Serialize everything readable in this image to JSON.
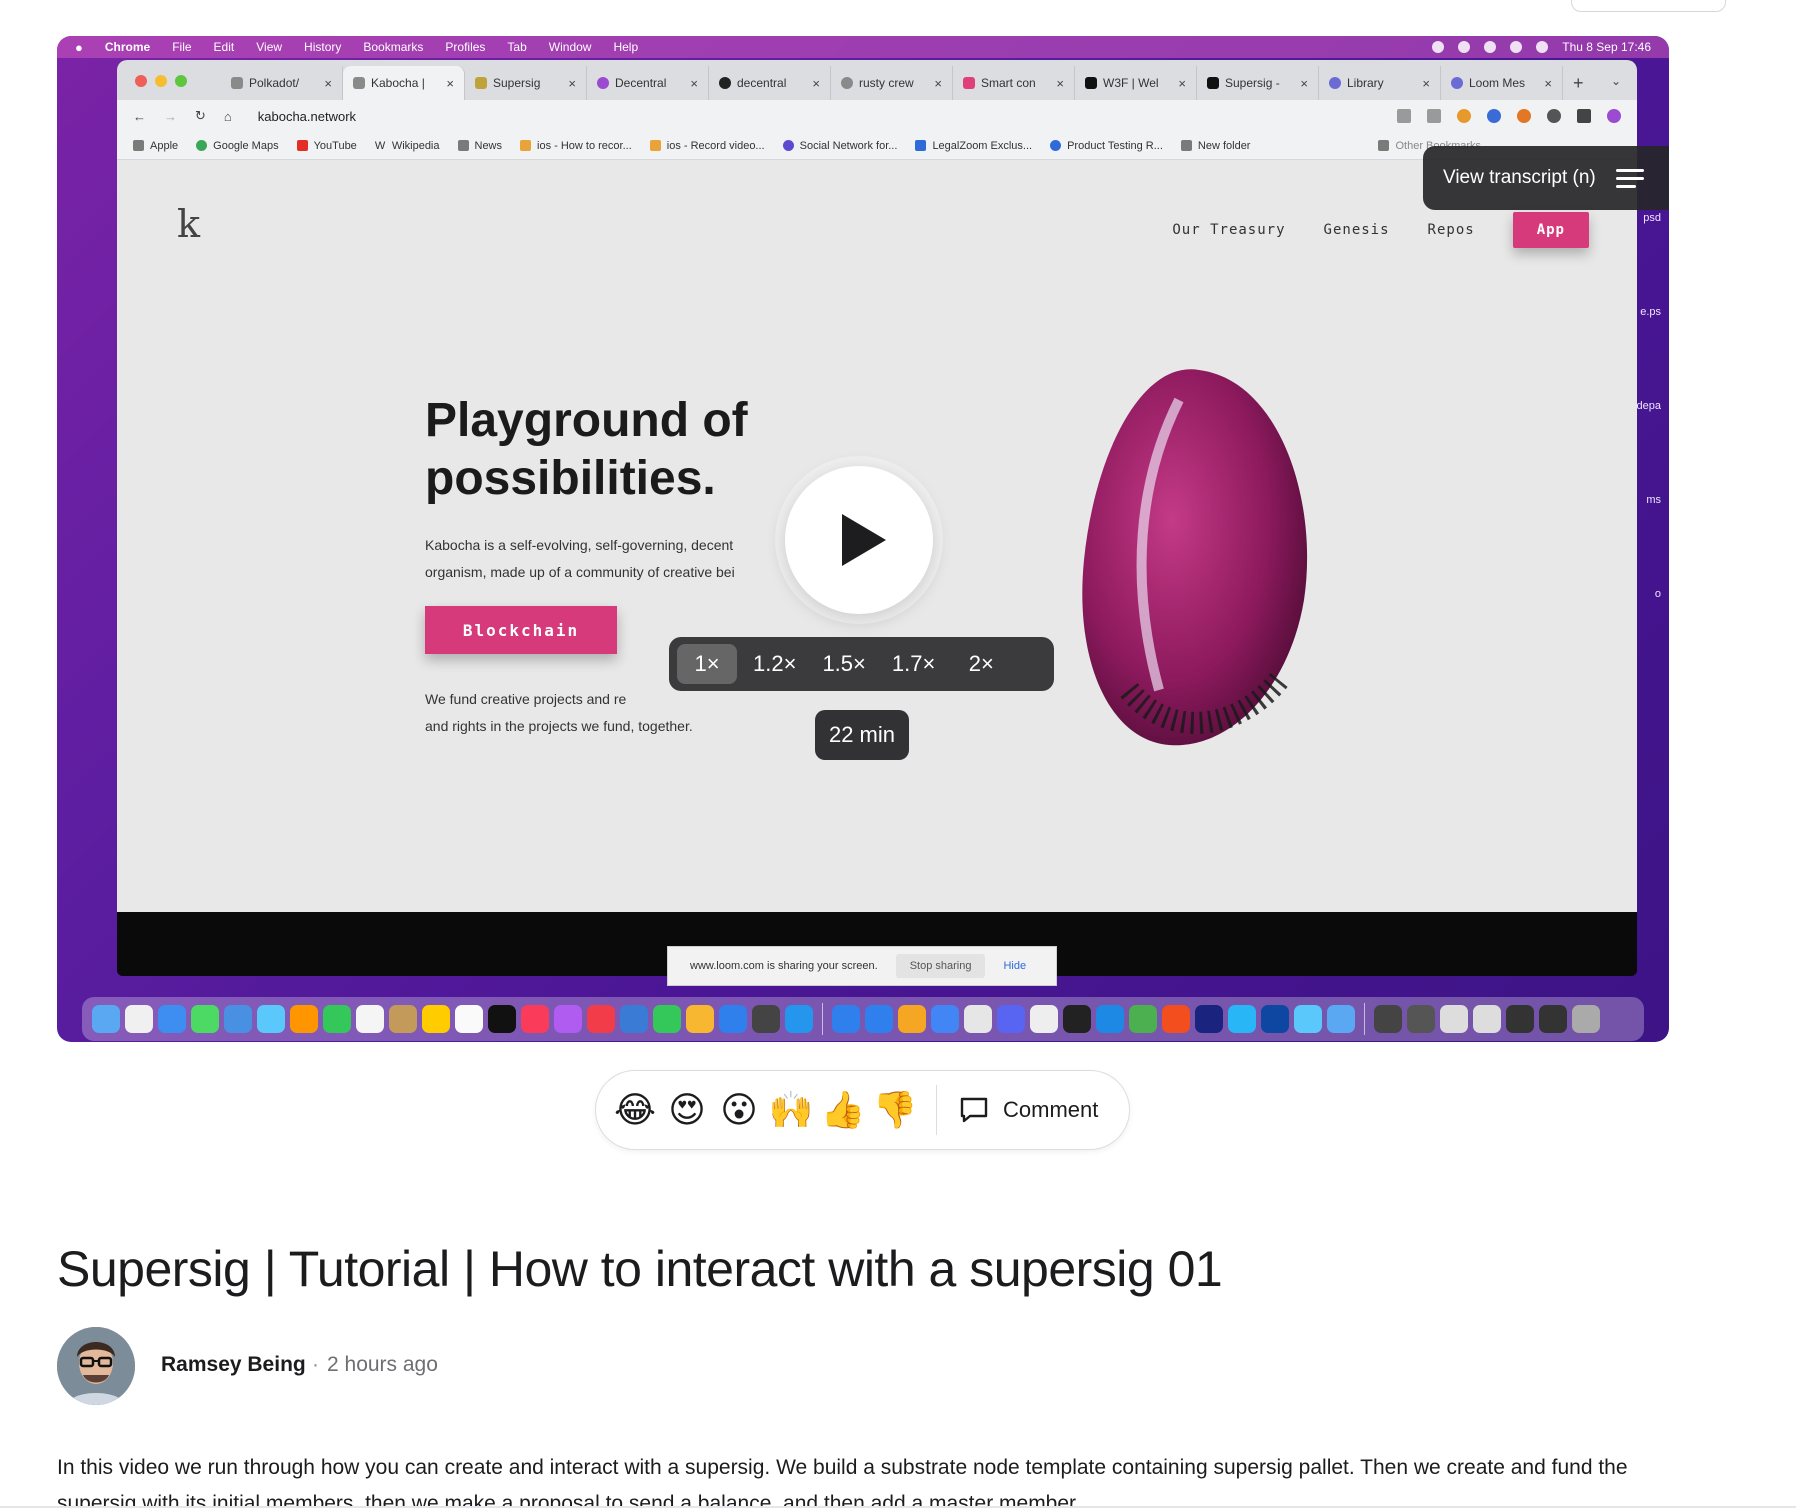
{
  "mac_menubar": {
    "app": "Chrome",
    "items": [
      "File",
      "Edit",
      "View",
      "History",
      "Bookmarks",
      "Profiles",
      "Tab",
      "Window",
      "Help"
    ],
    "clock": "Thu 8 Sep  17:46"
  },
  "browser": {
    "tabs": [
      {
        "label": "Polkadot/",
        "active": false
      },
      {
        "label": "Kabocha |",
        "active": true
      },
      {
        "label": "Supersig",
        "active": false
      },
      {
        "label": "Decentral",
        "active": false
      },
      {
        "label": "decentral",
        "active": false
      },
      {
        "label": "rusty crew",
        "active": false
      },
      {
        "label": "Smart con",
        "active": false
      },
      {
        "label": "W3F | Wel",
        "active": false
      },
      {
        "label": "Supersig -",
        "active": false
      },
      {
        "label": "Library",
        "active": false
      },
      {
        "label": "Loom Mes",
        "active": false
      }
    ],
    "url": "kabocha.network",
    "bookmarks": [
      "Apple",
      "Google Maps",
      "YouTube",
      "Wikipedia",
      "News",
      "ios - How to recor...",
      "ios - Record video...",
      "Social Network for...",
      "LegalZoom Exclus...",
      "Product Testing R...",
      "New folder",
      "Other Bookmarks"
    ]
  },
  "site": {
    "logo": "k",
    "nav": [
      "Our Treasury",
      "Genesis",
      "Repos"
    ],
    "app_button": "App",
    "hero_title_1": "Playground of",
    "hero_title_2": "possibilities.",
    "hero_desc_1": "Kabocha is a self-evolving, self-governing, decent",
    "hero_desc_2": "organism, made up of a community of creative bei",
    "hero_button": "Blockchain",
    "fund_1": "We fund creative projects and re",
    "fund_2": "and rights in the projects we fund, together."
  },
  "desktop_labels": [
    "psd",
    "e.ps",
    "depa",
    "ms",
    "o"
  ],
  "screen_share": {
    "message": "www.loom.com is sharing your screen.",
    "stop": "Stop sharing",
    "hide": "Hide"
  },
  "player": {
    "transcript_label": "View transcript (n)",
    "speeds": [
      "1×",
      "1.2×",
      "1.5×",
      "1.7×",
      "2×"
    ],
    "selected_speed": "1×",
    "duration": "22 min"
  },
  "reactions": {
    "emojis": [
      "😂",
      "😍",
      "😮",
      "🙌",
      "👍",
      "👎"
    ],
    "comment_label": "Comment"
  },
  "video": {
    "title": "Supersig | Tutorial | How to interact with a supersig 01",
    "author": "Ramsey Being",
    "separator": "·",
    "time_ago": "2 hours ago",
    "description": "In this video we run through how you can create and interact with a supersig. We build a substrate node template containing supersig pallet. Then we create and fund the supersig with its initial members, then we make a proposal to send a balance, and then add a master member."
  }
}
